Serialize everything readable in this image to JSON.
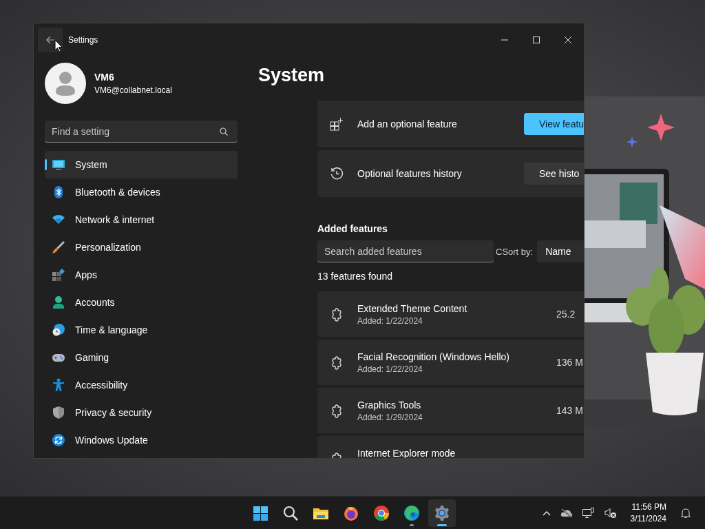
{
  "window": {
    "title": "Settings"
  },
  "profile": {
    "name": "VM6",
    "email": "VM6@collabnet.local"
  },
  "sidebar": {
    "search": {
      "placeholder": "Find a setting"
    },
    "items": [
      {
        "label": "System",
        "kind": "system",
        "selected": true
      },
      {
        "label": "Bluetooth & devices",
        "kind": "bluetooth",
        "selected": false
      },
      {
        "label": "Network & internet",
        "kind": "network",
        "selected": false
      },
      {
        "label": "Personalization",
        "kind": "brush",
        "selected": false
      },
      {
        "label": "Apps",
        "kind": "apps",
        "selected": false
      },
      {
        "label": "Accounts",
        "kind": "accounts",
        "selected": false
      },
      {
        "label": "Time & language",
        "kind": "time",
        "selected": false
      },
      {
        "label": "Gaming",
        "kind": "gaming",
        "selected": false
      },
      {
        "label": "Accessibility",
        "kind": "accessibility",
        "selected": false
      },
      {
        "label": "Privacy & security",
        "kind": "privacy",
        "selected": false
      },
      {
        "label": "Windows Update",
        "kind": "update",
        "selected": false
      }
    ]
  },
  "page": {
    "title": "System",
    "cards": [
      {
        "kind": "add",
        "label": "Add an optional feature",
        "button": "View featu",
        "primary": true
      },
      {
        "kind": "history",
        "label": "Optional features history",
        "button": "See histo",
        "primary": false
      }
    ],
    "section_title": "Added features",
    "search": {
      "placeholder": "Search added features"
    },
    "sort_label": "CSort by:",
    "sort_value": "Name",
    "count": "13 features found",
    "features": [
      {
        "name": "Extended Theme Content",
        "added": "Added: 1/22/2024",
        "size": "25.2"
      },
      {
        "name": "Facial Recognition (Windows Hello)",
        "added": "Added: 1/22/2024",
        "size": "136 M"
      },
      {
        "name": "Graphics Tools",
        "added": "Added: 1/29/2024",
        "size": "143 M"
      },
      {
        "name": "Internet Explorer mode"
      }
    ]
  },
  "taskbar": {
    "apps": [
      {
        "kind": "start",
        "running": false,
        "selected": false
      },
      {
        "kind": "search",
        "running": false,
        "selected": false
      },
      {
        "kind": "explorer",
        "running": false,
        "selected": false
      },
      {
        "kind": "firefox",
        "running": false,
        "selected": false
      },
      {
        "kind": "chrome",
        "running": false,
        "selected": false
      },
      {
        "kind": "edge",
        "running": true,
        "selected": false
      },
      {
        "kind": "settings",
        "running": true,
        "selected": true
      }
    ],
    "time": "11:56 PM",
    "date": "3/11/2024"
  }
}
